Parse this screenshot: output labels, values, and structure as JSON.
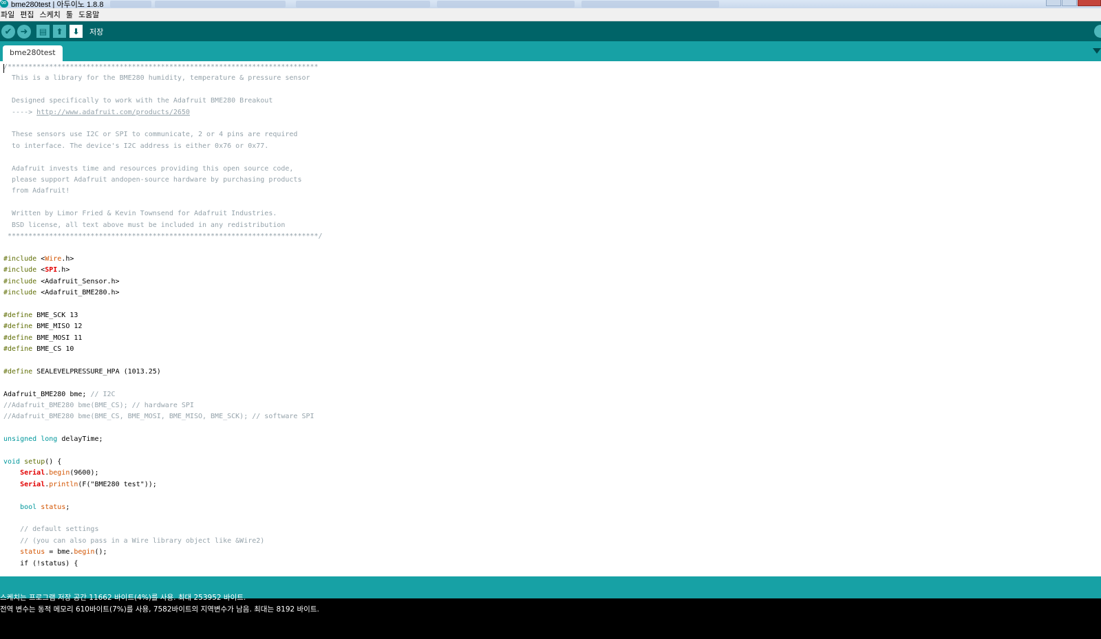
{
  "window": {
    "title": "bme280test | 아두이노 1.8.8"
  },
  "menu": [
    "파일",
    "편집",
    "스케치",
    "툴",
    "도움말"
  ],
  "toolbar": {
    "verify_icon": "check-icon",
    "upload_icon": "arrow-right-icon",
    "new_icon": "new-file-icon",
    "open_icon": "open-arrow-up-icon",
    "save_icon": "save-arrow-down-icon",
    "hover_label": "저장",
    "serial_monitor_icon": "magnifier-icon"
  },
  "tabs": [
    {
      "label": "bme280test"
    }
  ],
  "editor": {
    "lines": [
      [
        {
          "t": "/***************************************************************************",
          "c": "c-comment"
        }
      ],
      [
        {
          "t": "  This is a library for the BME280 humidity, temperature & pressure sensor",
          "c": "c-comment"
        }
      ],
      [],
      [
        {
          "t": "  Designed specifically to work with the Adafruit BME280 Breakout",
          "c": "c-comment"
        }
      ],
      [
        {
          "t": "  ----> ",
          "c": "c-comment"
        },
        {
          "t": "http://www.adafruit.com/products/2650",
          "c": "c-link"
        }
      ],
      [],
      [
        {
          "t": "  These sensors use I2C or SPI to communicate, 2 or 4 pins are required",
          "c": "c-comment"
        }
      ],
      [
        {
          "t": "  to interface. The device's I2C address is either 0x76 or 0x77.",
          "c": "c-comment"
        }
      ],
      [],
      [
        {
          "t": "  Adafruit invests time and resources providing this open source code,",
          "c": "c-comment"
        }
      ],
      [
        {
          "t": "  please support Adafruit andopen-source hardware by purchasing products",
          "c": "c-comment"
        }
      ],
      [
        {
          "t": "  from Adafruit!",
          "c": "c-comment"
        }
      ],
      [],
      [
        {
          "t": "  Written by Limor Fried & Kevin Townsend for Adafruit Industries.",
          "c": "c-comment"
        }
      ],
      [
        {
          "t": "  BSD license, all text above must be included in any redistribution",
          "c": "c-comment"
        }
      ],
      [
        {
          "t": " ***************************************************************************/",
          "c": "c-comment"
        }
      ],
      [],
      [
        {
          "t": "#include",
          "c": "c-kw"
        },
        {
          "t": " <",
          "c": ""
        },
        {
          "t": "Wire",
          "c": "c-fn"
        },
        {
          "t": ".h>",
          "c": ""
        }
      ],
      [
        {
          "t": "#include",
          "c": "c-kw"
        },
        {
          "t": " <",
          "c": ""
        },
        {
          "t": "SPI",
          "c": "c-kw2"
        },
        {
          "t": ".h>",
          "c": ""
        }
      ],
      [
        {
          "t": "#include",
          "c": "c-kw"
        },
        {
          "t": " <Adafruit_Sensor.h>",
          "c": ""
        }
      ],
      [
        {
          "t": "#include",
          "c": "c-kw"
        },
        {
          "t": " <Adafruit_BME280.h>",
          "c": ""
        }
      ],
      [],
      [
        {
          "t": "#define",
          "c": "c-kw"
        },
        {
          "t": " BME_SCK 13",
          "c": ""
        }
      ],
      [
        {
          "t": "#define",
          "c": "c-kw"
        },
        {
          "t": " BME_MISO 12",
          "c": ""
        }
      ],
      [
        {
          "t": "#define",
          "c": "c-kw"
        },
        {
          "t": " BME_MOSI 11",
          "c": ""
        }
      ],
      [
        {
          "t": "#define",
          "c": "c-kw"
        },
        {
          "t": " BME_CS 10",
          "c": ""
        }
      ],
      [],
      [
        {
          "t": "#define",
          "c": "c-kw"
        },
        {
          "t": " SEALEVELPRESSURE_HPA (1013.25)",
          "c": ""
        }
      ],
      [],
      [
        {
          "t": "Adafruit_BME280 bme; ",
          "c": ""
        },
        {
          "t": "// I2C",
          "c": "c-comment"
        }
      ],
      [
        {
          "t": "//Adafruit_BME280 bme(BME_CS); // hardware SPI",
          "c": "c-comment"
        }
      ],
      [
        {
          "t": "//Adafruit_BME280 bme(BME_CS, BME_MOSI, BME_MISO, BME_SCK); // software SPI",
          "c": "c-comment"
        }
      ],
      [],
      [
        {
          "t": "unsigned",
          "c": "c-type"
        },
        {
          "t": " ",
          "c": ""
        },
        {
          "t": "long",
          "c": "c-type"
        },
        {
          "t": " delayTime;",
          "c": ""
        }
      ],
      [],
      [
        {
          "t": "void",
          "c": "c-type"
        },
        {
          "t": " ",
          "c": ""
        },
        {
          "t": "setup",
          "c": "c-kw"
        },
        {
          "t": "() {",
          "c": ""
        }
      ],
      [
        {
          "t": "    ",
          "c": ""
        },
        {
          "t": "Serial",
          "c": "c-kw2"
        },
        {
          "t": ".",
          "c": ""
        },
        {
          "t": "begin",
          "c": "c-fn"
        },
        {
          "t": "(9600);",
          "c": ""
        }
      ],
      [
        {
          "t": "    ",
          "c": ""
        },
        {
          "t": "Serial",
          "c": "c-kw2"
        },
        {
          "t": ".",
          "c": ""
        },
        {
          "t": "println",
          "c": "c-fn"
        },
        {
          "t": "(F(\"BME280 test\"));",
          "c": ""
        }
      ],
      [],
      [
        {
          "t": "    ",
          "c": ""
        },
        {
          "t": "bool",
          "c": "c-type"
        },
        {
          "t": " ",
          "c": ""
        },
        {
          "t": "status",
          "c": "c-fn"
        },
        {
          "t": ";",
          "c": ""
        }
      ],
      [],
      [
        {
          "t": "    // default settings",
          "c": "c-comment"
        }
      ],
      [
        {
          "t": "    // (you can also pass in a Wire library object like &Wire2)",
          "c": "c-comment"
        }
      ],
      [
        {
          "t": "    ",
          "c": ""
        },
        {
          "t": "status",
          "c": "c-fn"
        },
        {
          "t": " = bme.",
          "c": ""
        },
        {
          "t": "begin",
          "c": "c-fn"
        },
        {
          "t": "();",
          "c": ""
        }
      ],
      [
        {
          "t": "    if (!status) {",
          "c": ""
        }
      ]
    ]
  },
  "console": {
    "lines": [
      "스케치는 프로그램 저장 공간 11662 바이트(4%)를 사용. 최대 253952 바이트.",
      "전역 변수는 동적 메모리 610바이트(7%)를 사용, 7582바이트의 지역변수가 남음.  최대는 8192 바이트."
    ]
  },
  "colors": {
    "toolbar": "#006468",
    "tabstrip": "#17a1a5",
    "button": "#4db7bb",
    "console_bg": "#000000"
  }
}
